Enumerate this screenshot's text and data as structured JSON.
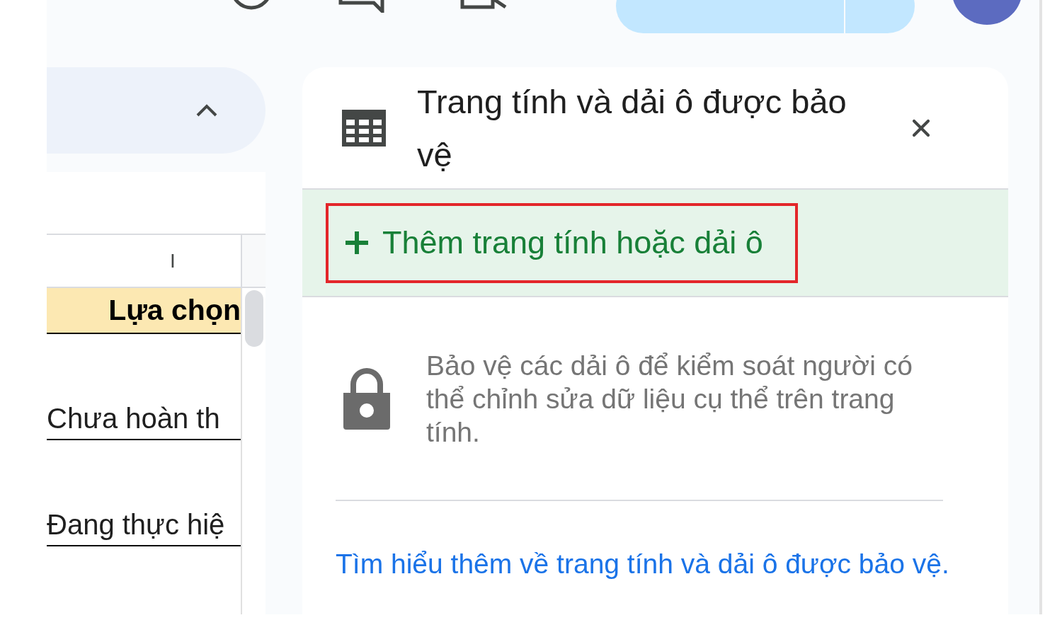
{
  "sheet": {
    "column_header": "I",
    "rows": [
      {
        "kind": "header",
        "text": "Lựa chọn"
      },
      {
        "kind": "value",
        "text": "Chưa hoàn th"
      },
      {
        "kind": "value",
        "text": "Đang thực hiệ"
      }
    ]
  },
  "panel": {
    "title": "Trang tính và dải ô được bảo vệ",
    "add_button": "Thêm trang tính hoặc dải ô",
    "description": "Bảo vệ các dải ô để kiểm soát người có thể chỉnh sửa dữ liệu cụ thể trên trang tính.",
    "link": "Tìm hiểu thêm về trang tính và dải ô được bảo vệ."
  }
}
